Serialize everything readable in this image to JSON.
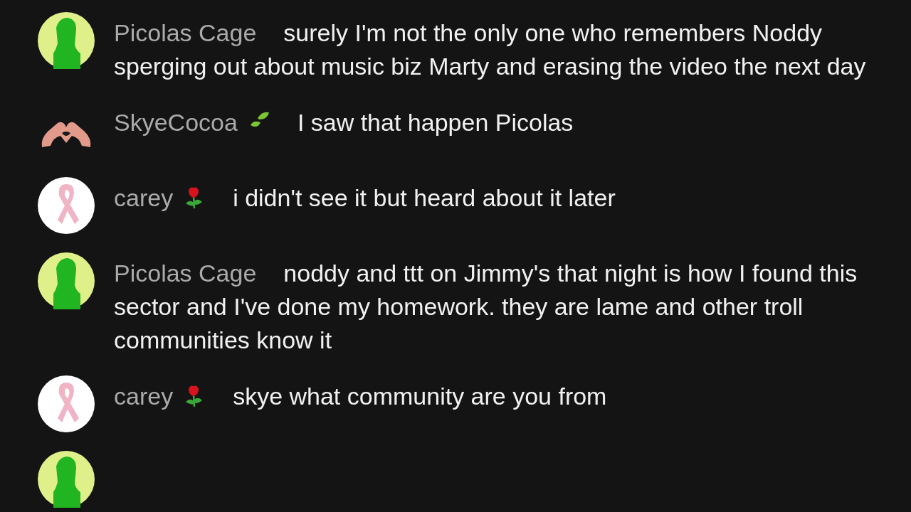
{
  "messages": [
    {
      "avatar": {
        "kind": "green-figure"
      },
      "author": "Picolas Cage",
      "text": "surely I'm not the only one who remembers Noddy sperging out about music biz Marty and erasing the video the next day"
    },
    {
      "avatar": {
        "kind": "hands-heart"
      },
      "author": "SkyeCocoa",
      "badge": {
        "kind": "leaf"
      },
      "text": "I saw that happen Picolas"
    },
    {
      "avatar": {
        "kind": "ribbon"
      },
      "author": "carey",
      "badge": {
        "kind": "rose"
      },
      "text": "i didn't see it but heard about it later"
    },
    {
      "avatar": {
        "kind": "green-figure"
      },
      "author": "Picolas Cage",
      "text": "noddy and ttt on Jimmy's that night is how I found this sector and I've done my homework. they are lame and other troll communities know it"
    },
    {
      "avatar": {
        "kind": "ribbon"
      },
      "author": "carey",
      "badge": {
        "kind": "rose"
      },
      "text": "skye what community are you from"
    },
    {
      "avatar": {
        "kind": "green-figure"
      }
    }
  ]
}
